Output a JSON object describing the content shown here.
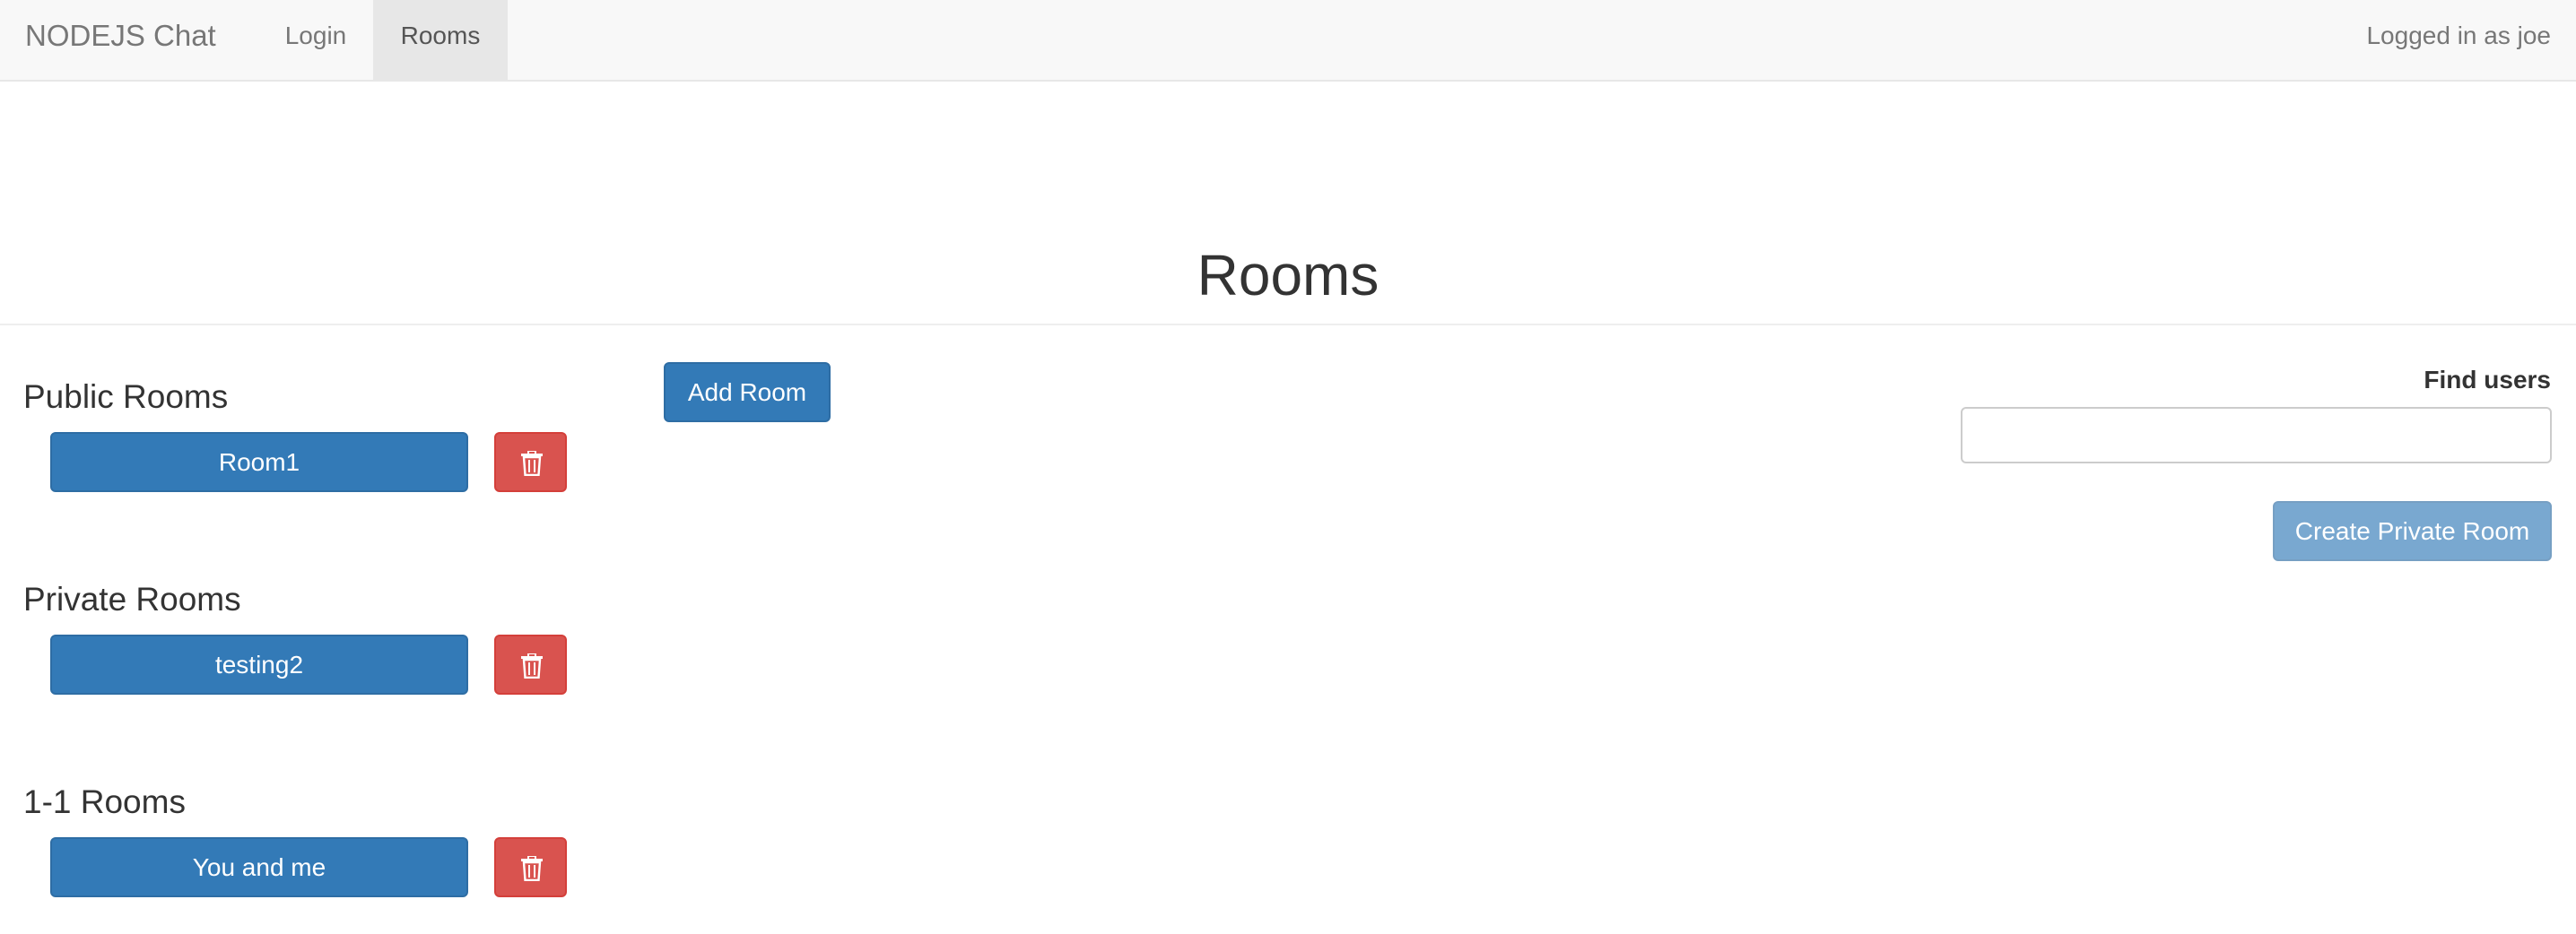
{
  "navbar": {
    "brand": "NODEJS Chat",
    "links": [
      {
        "label": "Login",
        "active": false
      },
      {
        "label": "Rooms",
        "active": true
      }
    ],
    "user_status": "Logged in as joe"
  },
  "page": {
    "title": "Rooms"
  },
  "sections": [
    {
      "title": "Public Rooms",
      "rooms": [
        "Room1"
      ]
    },
    {
      "title": "Private Rooms",
      "rooms": [
        "testing2"
      ]
    },
    {
      "title": "1-1 Rooms",
      "rooms": [
        "You and me"
      ]
    }
  ],
  "actions": {
    "add_room_label": "Add Room",
    "find_users_label": "Find users",
    "find_users_value": "",
    "create_private_room_label": "Create Private Room",
    "create_private_room_disabled": true
  },
  "icons": {
    "delete": "trash-icon"
  },
  "colors": {
    "primary": "#337ab7",
    "danger": "#d9534f",
    "navbar_bg": "#f8f8f8",
    "active_tab_bg": "#e7e7e7"
  }
}
